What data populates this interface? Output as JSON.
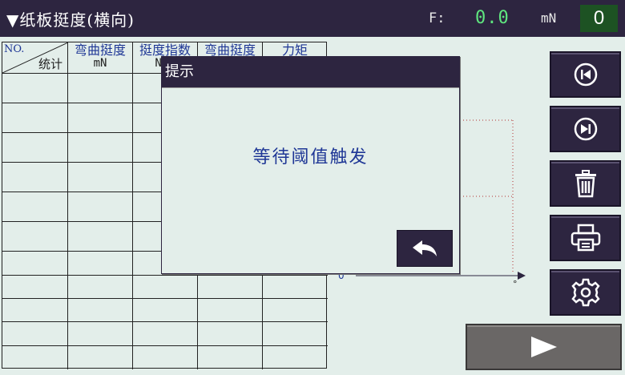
{
  "header": {
    "title": "▼纸板挺度(横向)",
    "force_label": "F:",
    "force_value": "0.0",
    "force_unit": "mN",
    "count": "0"
  },
  "table": {
    "corner_top": "NO.",
    "corner_bottom": "统计",
    "columns": [
      {
        "label": "弯曲挺度",
        "unit": "mN"
      },
      {
        "label": "挺度指数",
        "unit": "N.m"
      },
      {
        "label": "弯曲挺度",
        "unit": ""
      },
      {
        "label": "力矩",
        "unit": ""
      }
    ]
  },
  "chart": {
    "origin_label": "0",
    "degree_mark": "°"
  },
  "dialog": {
    "title": "提示",
    "message": "等待阈值触发",
    "back_icon": "undo-arrow-icon"
  },
  "side_buttons": [
    {
      "icon": "skip-previous-icon"
    },
    {
      "icon": "skip-next-icon"
    },
    {
      "icon": "trash-icon"
    },
    {
      "icon": "printer-icon"
    },
    {
      "icon": "gear-icon"
    }
  ],
  "run_button": {
    "icon": "play-icon"
  },
  "colors": {
    "header_bg": "#2d2540",
    "accent_text": "#1f3796",
    "value_green": "#5fe77f",
    "count_bg": "#1d5223",
    "background": "#e3eeea",
    "run_button_bg": "#6a6766"
  }
}
